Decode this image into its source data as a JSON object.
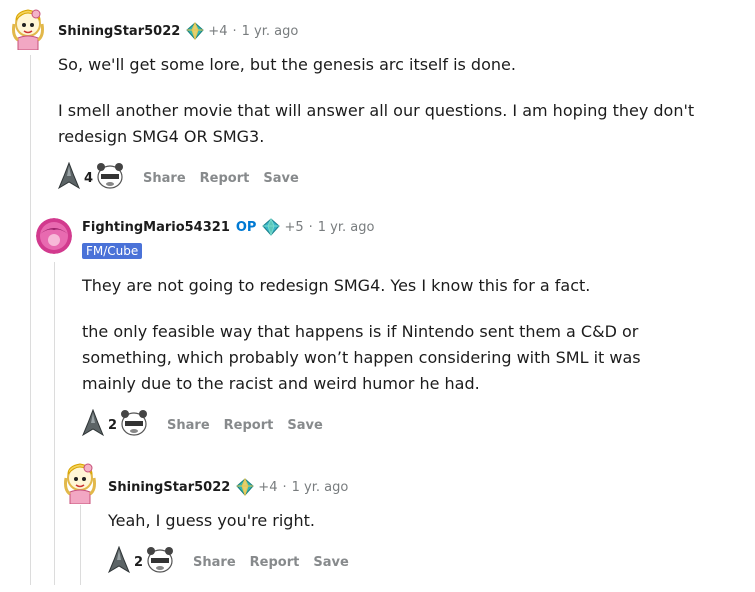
{
  "comments": [
    {
      "author": "ShiningStar5022",
      "karma": "+4",
      "sep": "·",
      "time": "1 yr. ago",
      "paragraphs": [
        "So, we'll get some lore, but the genesis arc itself is done.",
        "I smell another movie that will answer all our questions. I am hoping they don't redesign SMG4 OR SMG3."
      ],
      "score": "4",
      "actions": [
        "Share",
        "Report",
        "Save"
      ]
    },
    {
      "author": "FightingMario54321",
      "op_label": "OP",
      "karma": "+5",
      "sep": "·",
      "time": "1 yr. ago",
      "flair": "FM/Cube",
      "paragraphs": [
        "They are not going to redesign SMG4. Yes I know this for a fact.",
        "the only feasible way that happens is if Nintendo sent them a C&D or something, which probably won’t happen considering with SML it was mainly due to the racist and weird humor he had."
      ],
      "score": "2",
      "actions": [
        "Share",
        "Report",
        "Save"
      ]
    },
    {
      "author": "ShiningStar5022",
      "karma": "+4",
      "sep": "·",
      "time": "1 yr. ago",
      "paragraphs": [
        "Yeah, I guess you're right."
      ],
      "score": "2",
      "actions": [
        "Share",
        "Report",
        "Save"
      ]
    }
  ],
  "icons": {
    "upvote": "rocket-upvote-icon",
    "downvote": "panda-downvote-icon",
    "award": "diamond-award-icon"
  }
}
